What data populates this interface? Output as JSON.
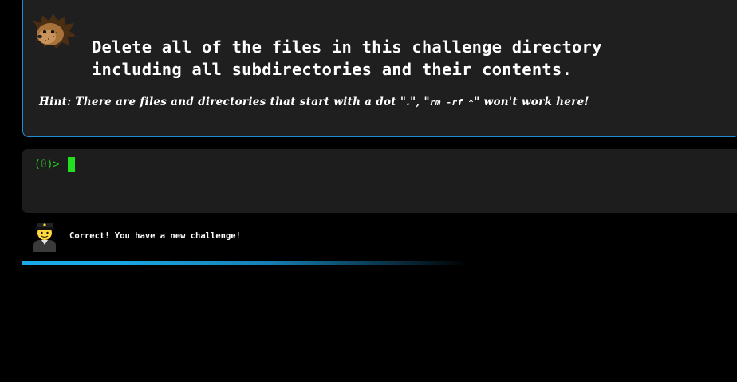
{
  "challenge": {
    "title": "Delete all of the files in this challenge directory including all subdirectories and their contents.",
    "hint_prefix": "Hint: There are files and directories that start with a dot \".\", \"",
    "hint_command": "rm -rf *",
    "hint_suffix": "\" won't work here!",
    "mascot_icon": "hedgehog-icon",
    "border_color": "#1f8ccf"
  },
  "terminal": {
    "prompt_open": "(",
    "prompt_count": "0",
    "prompt_close": ")>",
    "input_value": "",
    "prompt_color": "#22d11f"
  },
  "status": {
    "avatar_icon": "police-officer-icon",
    "message": "Correct! You have a new challenge!",
    "progress": 0.6
  }
}
